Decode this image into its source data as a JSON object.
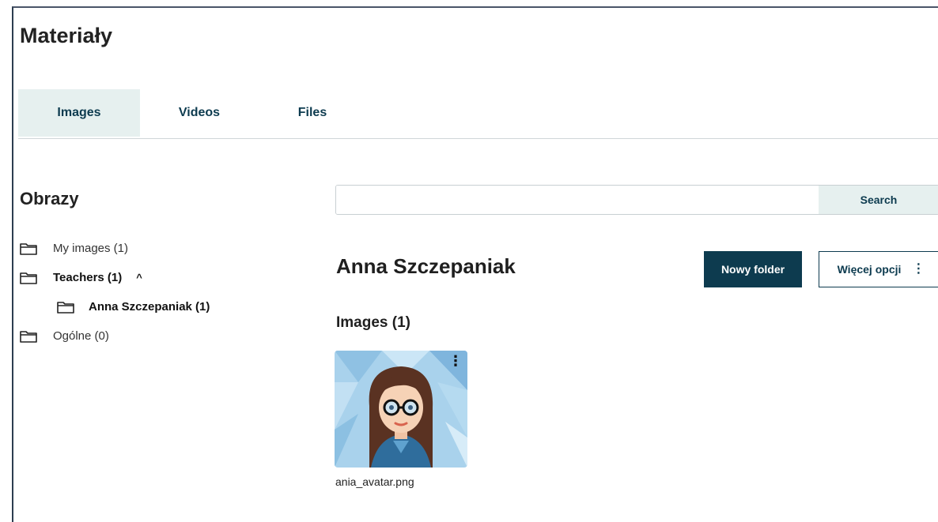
{
  "header": {
    "title": "Materiały"
  },
  "tabs": [
    {
      "label": "Images",
      "active": true
    },
    {
      "label": "Videos"
    },
    {
      "label": "Files"
    }
  ],
  "sidebar": {
    "title": "Obrazy",
    "items": [
      {
        "label": "My images (1)"
      },
      {
        "label": "Teachers (1)",
        "expanded": true
      },
      {
        "label": "Anna Szczepaniak (1)"
      },
      {
        "label": "Ogólne (0)"
      }
    ]
  },
  "search": {
    "value": "",
    "placeholder": "",
    "button_label": "Search"
  },
  "folder": {
    "title": "Anna Szczepaniak",
    "new_folder_label": "Nowy folder",
    "more_options_label": "Więcej opcji"
  },
  "images": {
    "heading": "Images (1)",
    "items": [
      {
        "filename": "ania_avatar.png"
      }
    ]
  },
  "colors": {
    "primary": "#0d3b4f",
    "tab_active_bg": "#e6f0ef"
  }
}
